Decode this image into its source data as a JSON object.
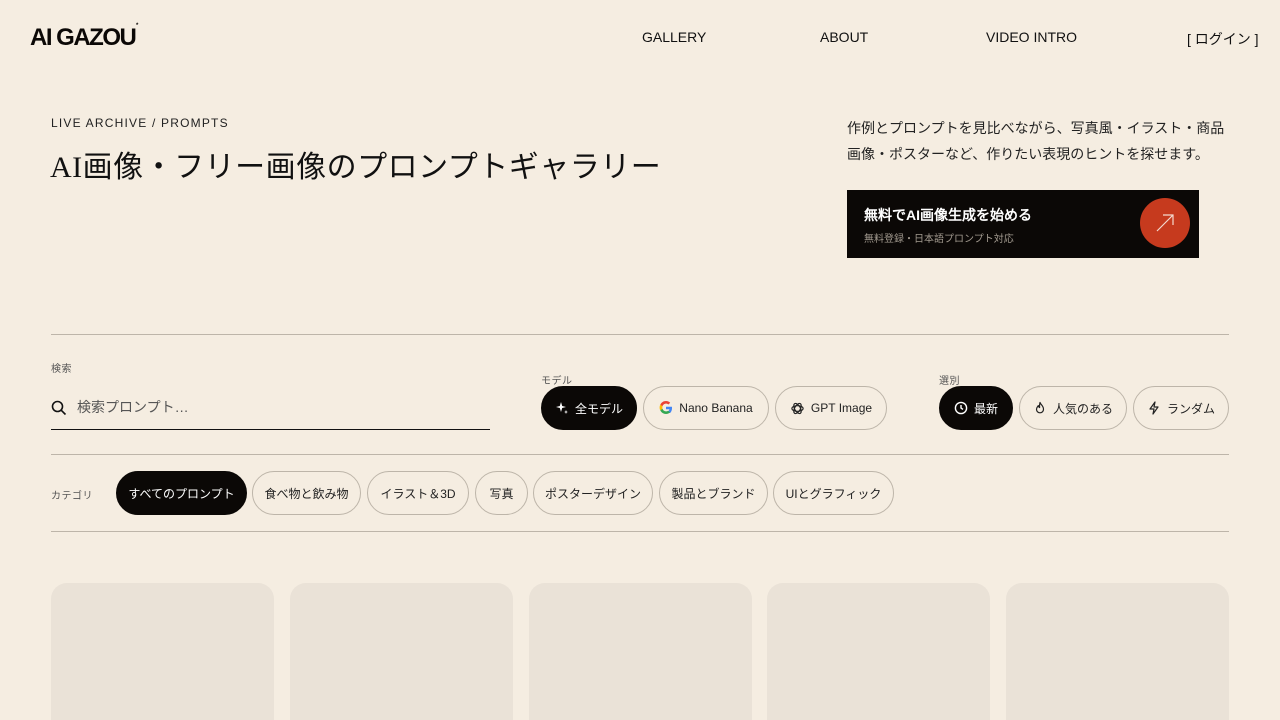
{
  "header": {
    "logo": "AI GAZOU",
    "logo_mark": "*",
    "nav": [
      "GALLERY",
      "ABOUT",
      "VIDEO INTRO"
    ],
    "login": "[ ログイン ]"
  },
  "hero": {
    "eyebrow": "LIVE ARCHIVE / PROMPTS",
    "title": "AI画像・フリー画像のプロンプトギャラリー",
    "description": "作例とプロンプトを見比べながら、写真風・イラスト・商品画像・ポスターなど、作りたい表現のヒントを探せます。",
    "cta_title": "無料でAI画像生成を始める",
    "cta_subtitle": "無料登録・日本語プロンプト対応",
    "cta_icon": "arrow-up-right-icon"
  },
  "filters": {
    "search_label": "検索",
    "search_placeholder": "検索プロンプト…",
    "model_label": "モデル",
    "models": [
      {
        "label": "全モデル",
        "icon": "sparkle-icon",
        "active": true
      },
      {
        "label": "Nano Banana",
        "icon": "google-icon",
        "active": false
      },
      {
        "label": "GPT Image",
        "icon": "openai-icon",
        "active": false
      }
    ],
    "sort_label": "選別",
    "sorts": [
      {
        "label": "最新",
        "icon": "clock-icon",
        "active": true
      },
      {
        "label": "人気のある",
        "icon": "flame-icon",
        "active": false
      },
      {
        "label": "ランダム",
        "icon": "bolt-icon",
        "active": false
      }
    ],
    "category_label": "カテゴリ",
    "categories": [
      {
        "label": "すべてのプロンプト",
        "active": true
      },
      {
        "label": "食べ物と飲み物",
        "active": false
      },
      {
        "label": "イラスト＆3D",
        "active": false
      },
      {
        "label": "写真",
        "active": false
      },
      {
        "label": "ポスターデザイン",
        "active": false
      },
      {
        "label": "製品とブランド",
        "active": false
      },
      {
        "label": "UIとグラフィック",
        "active": false
      }
    ]
  },
  "colors": {
    "background": "#f5ede1",
    "ink": "#0b0806",
    "accent": "#c63a1e",
    "card_placeholder": "#eae2d7"
  }
}
